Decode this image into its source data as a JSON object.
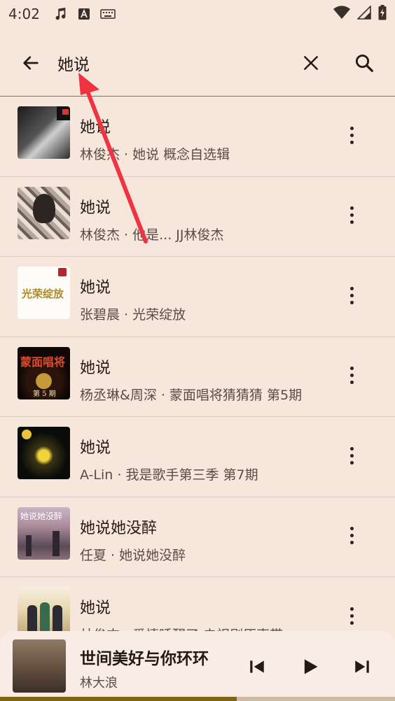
{
  "status_bar": {
    "time": "4:02",
    "icons": [
      "music-note-icon",
      "a-badge-icon",
      "keyboard-icon",
      "wifi-icon",
      "signal-icon",
      "battery-charging-icon"
    ]
  },
  "search": {
    "query": "她说",
    "icons": {
      "back": "arrow-left-icon",
      "clear": "close-icon",
      "search": "search-icon"
    }
  },
  "results": [
    {
      "title": "她说",
      "subtitle": "林俊杰 · 她说 概念自选辑"
    },
    {
      "title": "她说",
      "subtitle": "林俊杰 · 他是... JJ林俊杰"
    },
    {
      "title": "她说",
      "subtitle": "张碧晨 · 光荣绽放",
      "thumb_text": "光荣绽放"
    },
    {
      "title": "她说",
      "subtitle": "杨丞琳&周深 · 蒙面唱将猜猜猜 第5期",
      "thumb_text": "蒙面唱将",
      "thumb_text2": "第 5 期"
    },
    {
      "title": "她说",
      "subtitle": "A-Lin · 我是歌手第三季 第7期"
    },
    {
      "title": "她说她没醉",
      "subtitle": "任夏 · 她说她没醉",
      "thumb_text": "她说她没醉"
    },
    {
      "title": "她说",
      "subtitle": "林俊杰 · 爱情睡醒了 电视剧原声带"
    }
  ],
  "now_playing": {
    "title": "世间美好与你环环",
    "artist": "林大浪",
    "progress": 0.6
  },
  "colors": {
    "background": "#f6e6dc",
    "accent": "#7e6414",
    "annotation": "#ef3340"
  }
}
